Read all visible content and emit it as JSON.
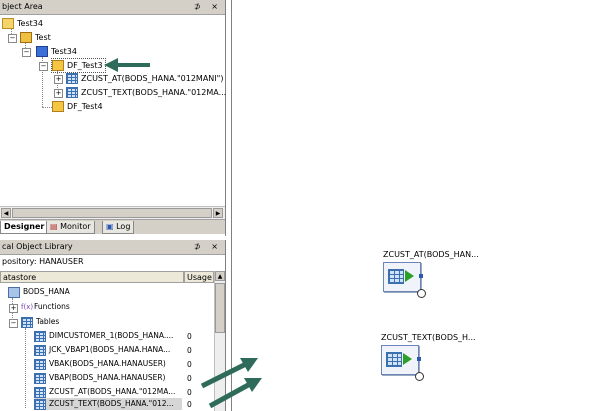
{
  "object_area": {
    "title": "bject Area",
    "pin": "⊅",
    "close": "×",
    "tree": [
      {
        "label": "Test34",
        "icon": "folder-icon"
      },
      {
        "label": "Test",
        "icon": "project-icon"
      },
      {
        "label": "Test34",
        "icon": "job-icon"
      },
      {
        "label": "DF_Test3",
        "icon": "dataflow-icon"
      },
      {
        "label": "ZCUST_AT(BODS_HANA.\"012MANI\")",
        "icon": "table-icon"
      },
      {
        "label": "ZCUST_TEXT(BODS_HANA.\"012MA...",
        "icon": "table-icon"
      },
      {
        "label": "DF_Test4",
        "icon": "dataflow-icon"
      }
    ],
    "tabs": [
      "Designer",
      "Monitor",
      "Log"
    ]
  },
  "library": {
    "title": "cal Object Library",
    "pin": "⊅",
    "close": "×",
    "repository": "pository: HANAUSER",
    "columns": {
      "datastore": "atastore",
      "usage": "Usage"
    },
    "datastore": "BODS_HANA",
    "functions_label": "Functions",
    "functions_glyph": "f(x)",
    "tables_label": "Tables",
    "tables": [
      {
        "name": "DIMCUSTOMER_1(BODS_HANA....",
        "usage": "0"
      },
      {
        "name": "JCK_VBAP1(BODS_HANA.HANA...",
        "usage": "0"
      },
      {
        "name": "VBAK(BODS_HANA.HANAUSER)",
        "usage": "0"
      },
      {
        "name": "VBAP(BODS_HANA.HANAUSER)",
        "usage": "0"
      },
      {
        "name": "ZCUST_AT(BODS_HANA.\"012MA...",
        "usage": "0"
      },
      {
        "name": "ZCUST_TEXT(BODS_HANA.\"012...",
        "usage": "0"
      }
    ]
  },
  "workspace": {
    "nodes": [
      {
        "label": "ZCUST_AT(BODS_HAN..."
      },
      {
        "label": "ZCUST_TEXT(BODS_H..."
      }
    ]
  },
  "colors": {
    "arrow": "#2f6b5a",
    "panel_bar": "#d4d0c8"
  }
}
